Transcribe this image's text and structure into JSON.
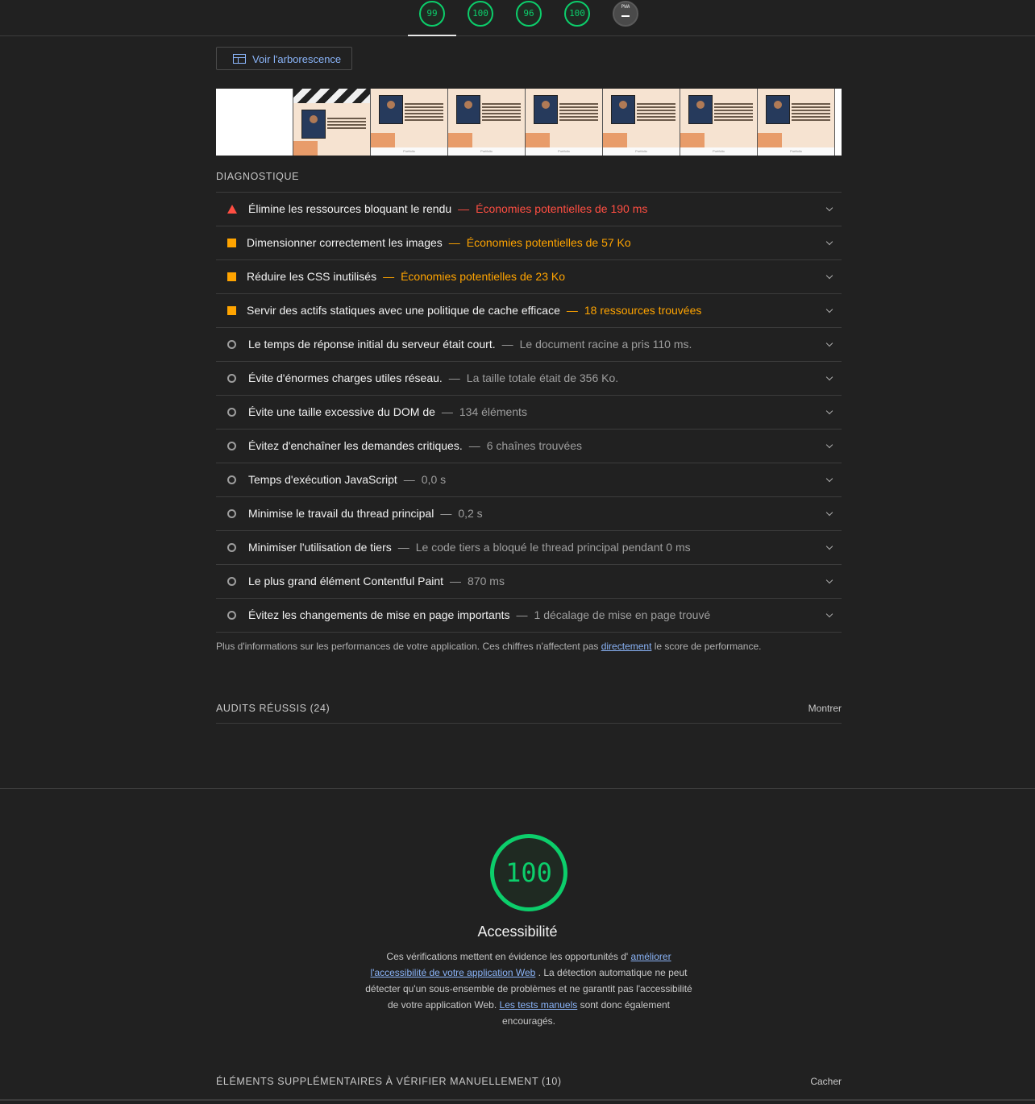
{
  "top_scores": [
    {
      "label": "99",
      "color": "#0cce6b"
    },
    {
      "label": "100",
      "color": "#0cce6b"
    },
    {
      "label": "96",
      "color": "#0cce6b"
    },
    {
      "label": "100",
      "color": "#0cce6b"
    },
    {
      "label": "PWA",
      "color": "#9e9e9e"
    }
  ],
  "tree_button": {
    "label": "Voir l'arborescence",
    "icon": "treemap-icon"
  },
  "diagnostics": {
    "heading": "DIAGNOSTIQUE",
    "items": [
      {
        "status": "fail",
        "title": "Élimine les ressources bloquant le rendu",
        "separator": "—",
        "display": "Économies potentielles de 190 ms"
      },
      {
        "status": "average",
        "title": "Dimensionner correctement les images",
        "separator": "—",
        "display": "Économies potentielles de 57 Ko"
      },
      {
        "status": "average",
        "title": "Réduire les CSS inutilisés",
        "separator": "—",
        "display": "Économies potentielles de 23 Ko"
      },
      {
        "status": "average",
        "title": "Servir des actifs statiques avec une politique de cache efficace",
        "separator": "—",
        "display": "18 ressources trouvées"
      },
      {
        "status": "info",
        "title": "Le temps de réponse initial du serveur était court.",
        "separator": "—",
        "display": "Le document racine a pris 110 ms."
      },
      {
        "status": "info",
        "title": "Évite d'énormes charges utiles réseau.",
        "separator": "—",
        "display": "La taille totale était de 356 Ko."
      },
      {
        "status": "info",
        "title": "Évite une taille excessive du DOM de",
        "separator": "—",
        "display": "134 éléments"
      },
      {
        "status": "info",
        "title": "Évitez d'enchaîner les demandes critiques.",
        "separator": "—",
        "display": "6 chaînes trouvées"
      },
      {
        "status": "info",
        "title": "Temps d'exécution JavaScript",
        "separator": "—",
        "display": "0,0 s"
      },
      {
        "status": "info",
        "title": "Minimise le travail du thread principal",
        "separator": "—",
        "display": "0,2 s"
      },
      {
        "status": "info",
        "title": "Minimiser l'utilisation de tiers",
        "separator": "—",
        "display": "Le code tiers a bloqué le thread principal pendant 0 ms"
      },
      {
        "status": "info",
        "title": "Le plus grand élément Contentful Paint",
        "separator": "—",
        "display": "870 ms"
      },
      {
        "status": "info",
        "title": "Évitez les changements de mise en page importants",
        "separator": "—",
        "display": "1 décalage de mise en page trouvé"
      }
    ],
    "note_before": "Plus d'informations sur les performances de votre application. Ces chiffres n'affectent pas ",
    "note_link": "directement",
    "note_after": " le score de performance."
  },
  "passed": {
    "label": "AUDITS RÉUSSIS (24)",
    "toggle": "Montrer"
  },
  "accessibility": {
    "score": "100",
    "title": "Accessibilité",
    "desc_1": "Ces vérifications mettent en évidence les opportunités d' ",
    "desc_link_1": "améliorer l'accessibilité de votre application Web",
    "desc_2": " . La détection automatique ne peut détecter qu'un sous-ensemble de problèmes et ne garantit pas l'accessibilité de votre application Web. ",
    "desc_link_2": "Les tests manuels",
    "desc_3": " sont donc également encouragés."
  },
  "manual": {
    "label": "ÉLÉMENTS SUPPLÉMENTAIRES À VÉRIFIER MANUELLEMENT (10)",
    "toggle": "Cacher"
  },
  "filmstrip": {
    "frames": [
      "blank",
      "loading",
      "content",
      "content",
      "content",
      "content",
      "content",
      "content"
    ],
    "footer_text": "Portfolio"
  },
  "colors": {
    "pass": "#0cce6b",
    "average": "#ffa400",
    "fail": "#ff4e42",
    "link": "#8ab4f8"
  }
}
